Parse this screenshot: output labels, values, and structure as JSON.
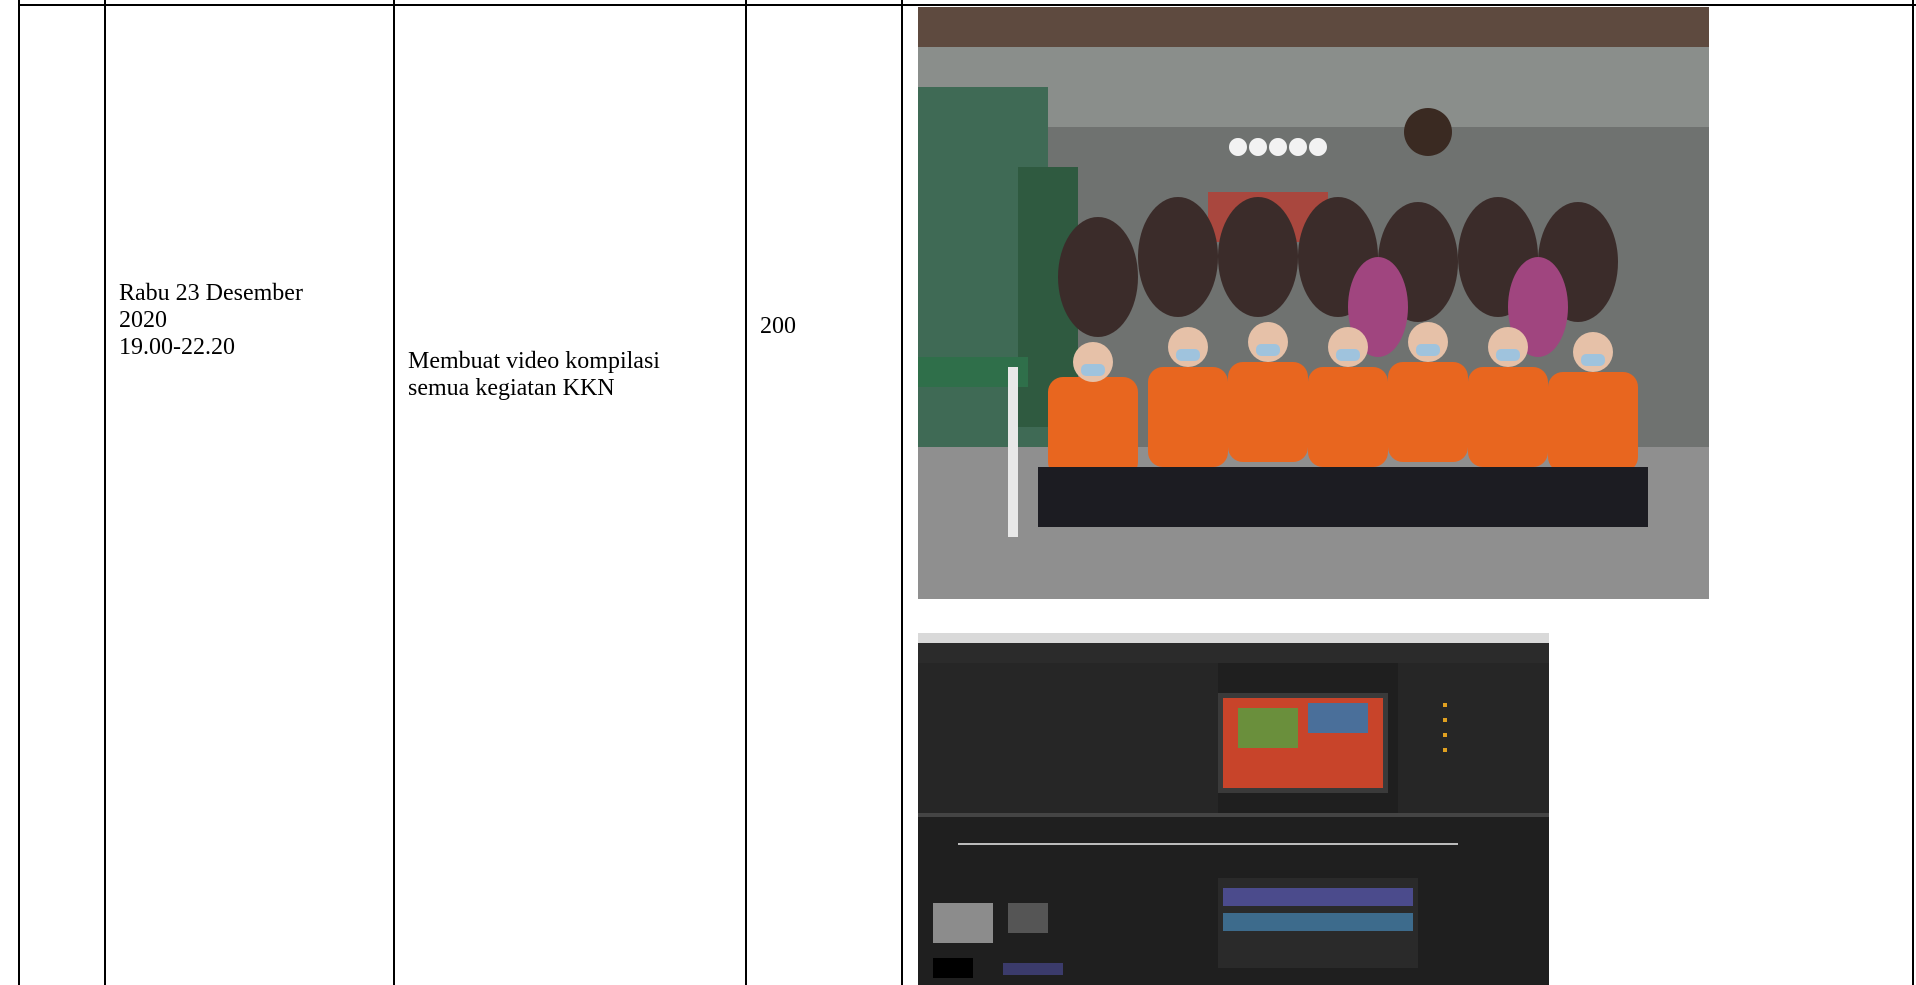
{
  "table": {
    "row": {
      "date_cell": "Rabu 23  Desember\n2020\n19.00-22.20",
      "activity_cell": "Membuat video kompilasi\nsemua kegiatan KKN",
      "duration_cell": "200",
      "photos": [
        {
          "subject": "group photo of KKN students in orange jackets wearing masks"
        },
        {
          "subject": "screenshot of video editing software timeline"
        }
      ]
    }
  }
}
